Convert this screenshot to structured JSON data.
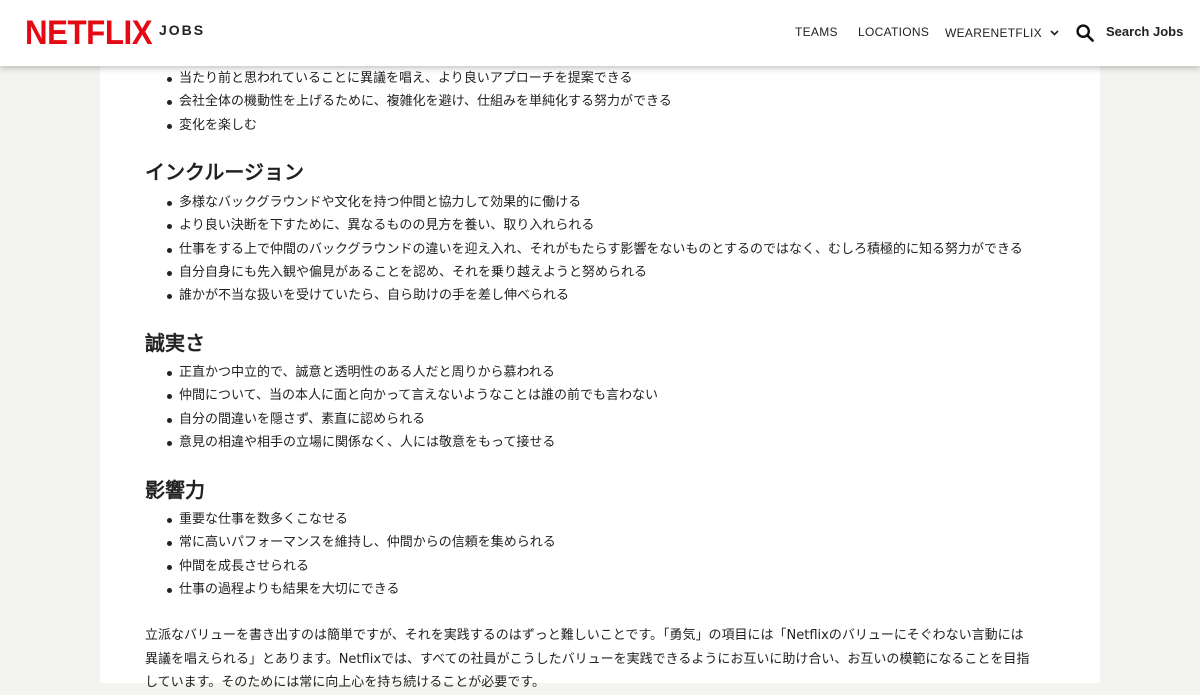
{
  "header": {
    "logo": "NETFLIX",
    "jobs": "JOBS",
    "nav": [
      "TEAMS",
      "LOCATIONS",
      "WEARENETFLIX"
    ],
    "search_label": "Search Jobs",
    "brand_color": "#e50914"
  },
  "sections": [
    {
      "heading": "",
      "items": [
        "当たり前と思われていることに異議を唱え、より良いアプローチを提案できる",
        "会社全体の機動性を上げるために、複雑化を避け、仕組みを単純化する努力ができる",
        "変化を楽しむ"
      ]
    },
    {
      "heading": "インクルージョン",
      "items": [
        "多様なバックグラウンドや文化を持つ仲間と協力して効果的に働ける",
        "より良い決断を下すために、異なるものの見方を養い、取り入れられる",
        "仕事をする上で仲間のバックグラウンドの違いを迎え入れ、それがもたらす影響をないものとするのではなく、むしろ積極的に知る努力ができる",
        "自分自身にも先入観や偏見があることを認め、それを乗り越えようと努められる",
        "誰かが不当な扱いを受けていたら、自ら助けの手を差し伸べられる"
      ]
    },
    {
      "heading": "誠実さ",
      "items": [
        "正直かつ中立的で、誠意と透明性のある人だと周りから慕われる",
        "仲間について、当の本人に面と向かって言えないようなことは誰の前でも言わない",
        "自分の間違いを隠さず、素直に認められる",
        "意見の相違や相手の立場に関係なく、人には敬意をもって接せる"
      ]
    },
    {
      "heading": "影響力",
      "items": [
        "重要な仕事を数多くこなせる",
        "常に高いパフォーマンスを維持し、仲間からの信頼を集められる",
        "仲間を成長させられる",
        "仕事の過程よりも結果を大切にできる"
      ]
    }
  ],
  "paragraph": {
    "line1": "立派なバリューを書き出すのは簡単ですが、それを実践するのはずっと難しいことです。「勇気」の項目には「Netflixのバリューにそぐわない言動には",
    "line2": "異議を唱えられる」とあります。Netflixでは、すべての社員がこうしたバリューを実践できるようにお互いに助け合い、お互いの模範になることを目指",
    "line3": "しています。そのためには常に向上心を持ち続けることが必要です。"
  }
}
